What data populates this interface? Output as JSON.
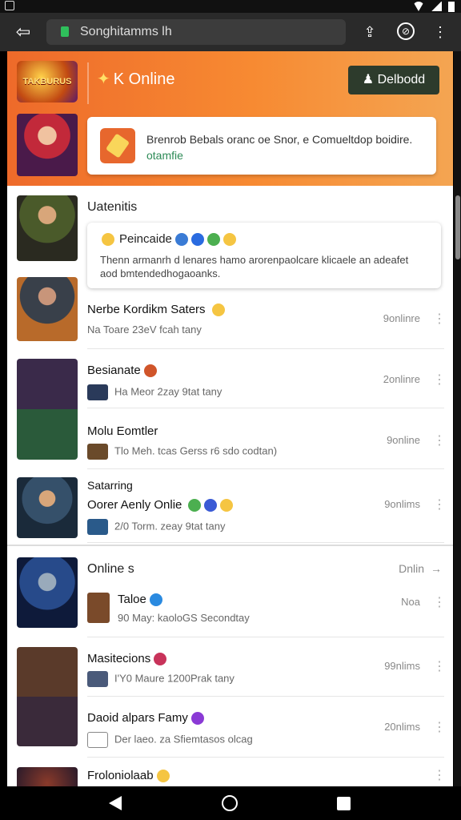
{
  "browser": {
    "url": "Songhitamms lh",
    "back_icon": "back-arrow-icon",
    "actions": [
      "share-icon",
      "lens-icon",
      "more-vert-icon"
    ]
  },
  "hero": {
    "logo_text": "TAKBURUS",
    "brand_label": "K Online",
    "download_label": "Delbodd",
    "card_text": "Brenrob Bebals oranc oe Snor, e Comueltdop boidire.",
    "card_link": "otamfie"
  },
  "section1": {
    "title": "Uatenitis",
    "popup_head": "Peincaide",
    "popup_body": "Thenn armanrh d lenares hamo arorenpaolcare klicaele an adeafet aod bmtendedhogaoanks."
  },
  "rows": [
    {
      "name": "Nerbe Kordikm Saters",
      "meta": "Na Toare 23eV fcah tany",
      "count": "9onlinre"
    },
    {
      "name": "Besianate",
      "meta": "Ha Meor 2zay 9tat tany",
      "count": "2onlinre"
    },
    {
      "name": "Molu Eomtler",
      "meta": "Tlo Meh. tcas Gerss r6 sdo codtan)",
      "count": "9online"
    },
    {
      "name": "Oorer Aenly Onlie",
      "pre": "Satarring",
      "meta": "2/0 Torm. zeay 9tat tany",
      "count": "9onlims"
    }
  ],
  "section2": {
    "title": "Online s",
    "link": "Dnlin",
    "rows": [
      {
        "name": "Taloe",
        "meta": "90 May: kaoloGS Secondtay",
        "count": "Noa"
      },
      {
        "name": "Masitecions",
        "meta": "I'Y0 Maure 1200Prak tany",
        "count": "99nlims"
      },
      {
        "name": "Daoid alpars Famy",
        "meta": "Der laeo. za Sfiemtasos olcag",
        "count": "20nlims"
      },
      {
        "name": "Froloniolaab",
        "meta": "",
        "count": ""
      }
    ]
  },
  "colors": {
    "accent": "#ef6c2c",
    "download_bg": "#2d3b2c"
  }
}
